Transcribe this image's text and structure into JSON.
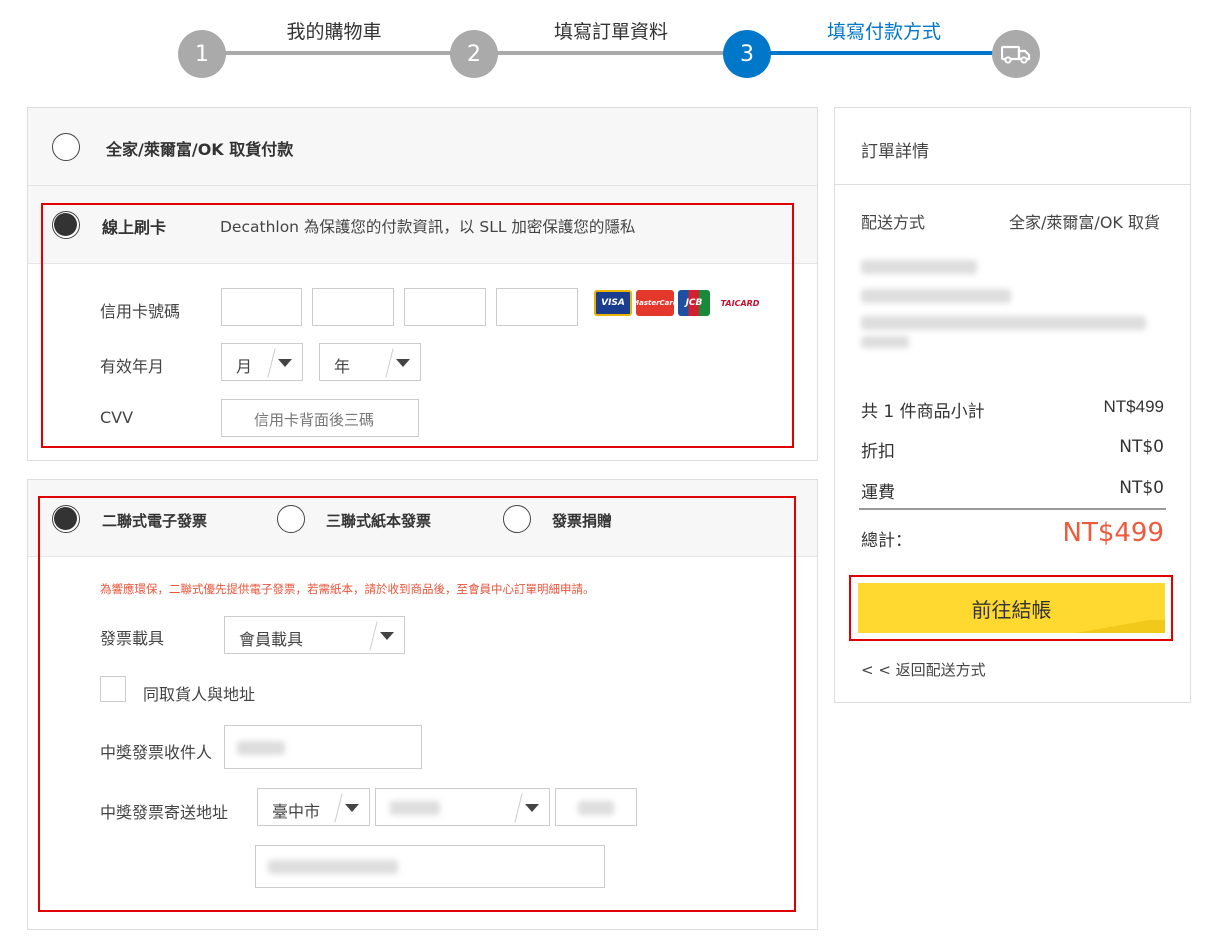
{
  "steps": [
    {
      "num": "1",
      "label": "我的購物車",
      "state": "done"
    },
    {
      "num": "2",
      "label": "填寫訂單資料",
      "state": "done"
    },
    {
      "num": "3",
      "label": "填寫付款方式",
      "state": "active"
    },
    {
      "num": "",
      "label": "",
      "icon": "truck-icon",
      "state": "pending"
    }
  ],
  "colors": {
    "step_gray": "#aaaaaa",
    "step_active": "#0077c8",
    "highlight_red": "#e00000",
    "price_red": "#f05a3c",
    "button_yellow": "#ffd92f"
  },
  "payment": {
    "option_store": "全家/萊爾富/OK 取貨付款",
    "option_card": "線上刷卡",
    "card_note": "Decathlon 為保護您的付款資訊，以 SLL 加密保護您的隱私",
    "card_number_label": "信用卡號碼",
    "expiry_label": "有效年月",
    "month_value": "月",
    "year_value": "年",
    "cvv_label": "CVV",
    "cvv_placeholder": "信用卡背面後三碼",
    "card_brands": [
      "VISA",
      "MasterCard",
      "JCB",
      "TAICARD"
    ]
  },
  "invoice": {
    "option_e": "二聯式電子發票",
    "option_paper": "三聯式紙本發票",
    "option_donate": "發票捐贈",
    "notice": "為響應環保，二聯式優先提供電子發票，若需紙本，請於收到商品後，至會員中心訂單明細申請。",
    "carrier_label": "發票載具",
    "carrier_value": "會員載具",
    "same_as_receiver": "同取貨人與地址",
    "winner_name_label": "中獎發票收件人",
    "winner_address_label": "中獎發票寄送地址",
    "city_value": "臺中市"
  },
  "summary": {
    "title": "訂單詳情",
    "shipping_label": "配送方式",
    "shipping_value": "全家/萊爾富/OK 取貨",
    "subtotal_label": "共 1 件商品小計",
    "subtotal_value": "NT$499",
    "discount_label": "折扣",
    "discount_value": "NT$0",
    "freight_label": "運費",
    "freight_value": "NT$0",
    "total_label": "總計：",
    "total_value": "NT$499",
    "checkout_button": "前往結帳",
    "back_link": "< < 返回配送方式"
  }
}
